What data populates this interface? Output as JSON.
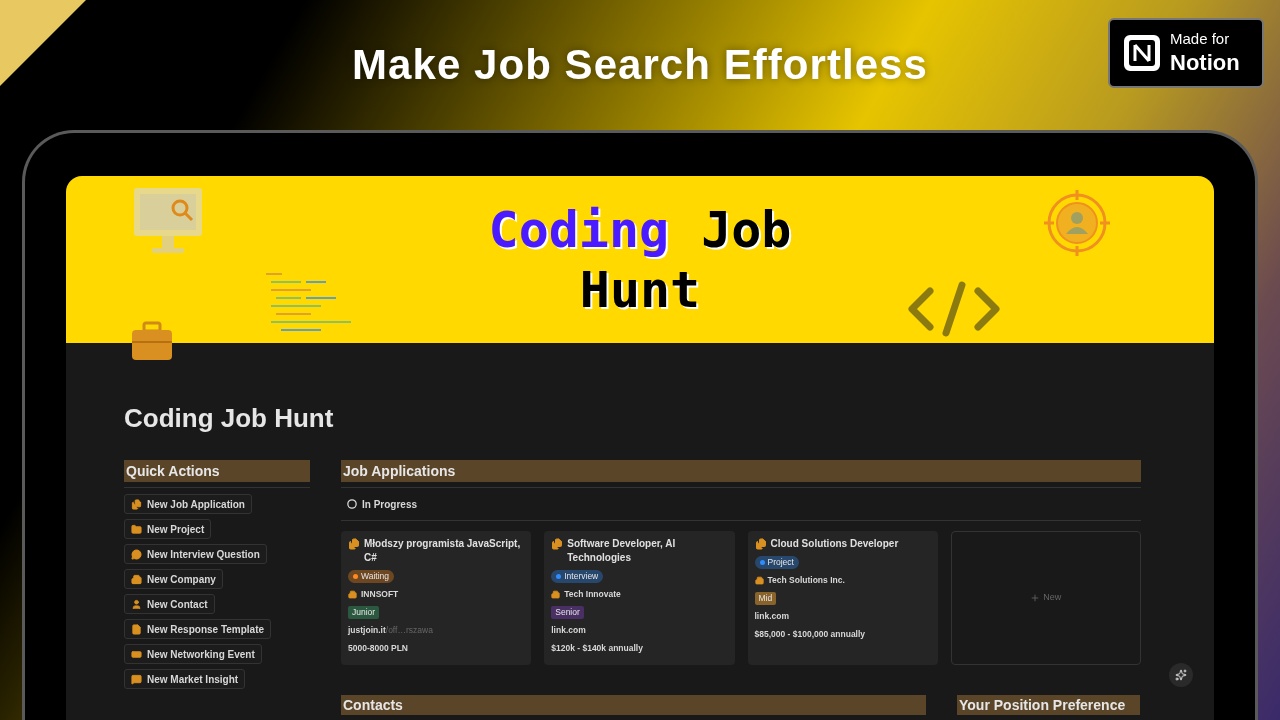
{
  "headline": "Make Job Search Effortless",
  "badge": {
    "line1": "Made for",
    "line2": "Notion"
  },
  "cover": {
    "title_words": [
      {
        "text": "Coding",
        "color": "#4b1bff"
      },
      {
        "text": "Job",
        "color": "#000000"
      },
      {
        "text": "Hunt",
        "color": "#000000"
      }
    ]
  },
  "page_title": "Coding Job Hunt",
  "quick_actions": {
    "heading": "Quick Actions",
    "buttons": [
      "New Job Application",
      "New Project",
      "New Interview Question",
      "New Company",
      "New Contact",
      "New Response Template",
      "New Networking Event",
      "New Market Insight"
    ]
  },
  "job_applications": {
    "heading": "Job Applications",
    "group": "In Progress",
    "new_label": "New",
    "cards": [
      {
        "title": "Młodszy programista JavaScript, C#",
        "status": {
          "text": "Waiting",
          "color": "#ff8a1f"
        },
        "company": "INNSOFT",
        "level": {
          "text": "Junior",
          "color": "#2b593f"
        },
        "link": "justjoin.it",
        "link_rest": "/off…rszawa",
        "salary": "5000-8000 PLN"
      },
      {
        "title": "Software Developer, AI Technologies",
        "status": {
          "text": "Interview",
          "color": "#2f8cff"
        },
        "company": "Tech Innovate",
        "level": {
          "text": "Senior",
          "color": "#492f64"
        },
        "link": "link.com",
        "salary": "$120k - $140k annually"
      },
      {
        "title": "Cloud Solutions Developer",
        "status": {
          "text": "Project",
          "color": "#2f8cff"
        },
        "company": "Tech Solutions Inc.",
        "level": {
          "text": "Mid",
          "color": "#89632a"
        },
        "link": "link.com",
        "salary": "$85,000 - $100,000 annually"
      }
    ]
  },
  "bottom_sections": [
    "Contacts",
    "Your Position Preference"
  ]
}
